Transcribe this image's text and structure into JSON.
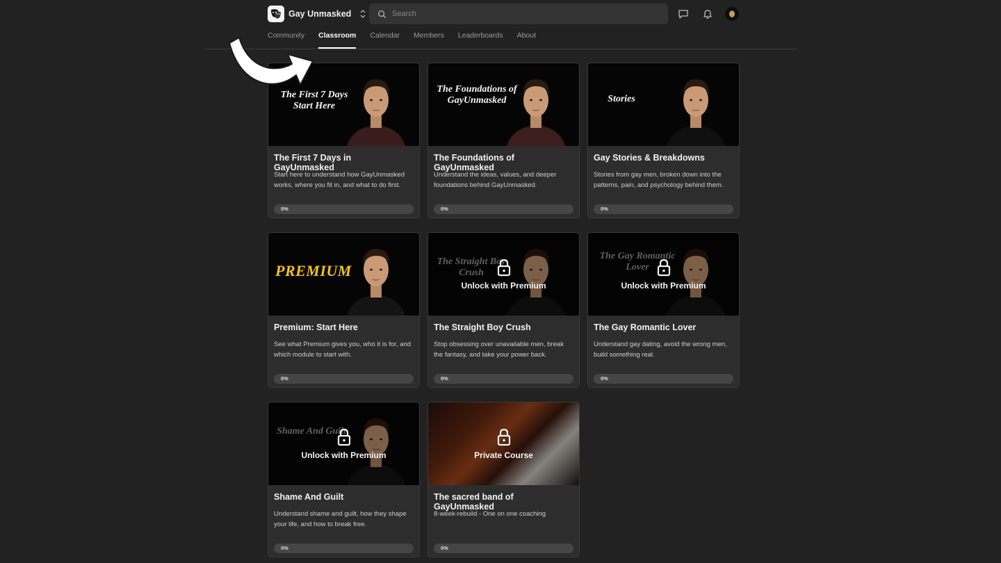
{
  "header": {
    "brand_name": "Gay Unmasked",
    "search_placeholder": "Search",
    "accent": "#ffffff"
  },
  "nav": {
    "tabs": [
      {
        "label": "Community",
        "active": false
      },
      {
        "label": "Classroom",
        "active": true
      },
      {
        "label": "Calendar",
        "active": false
      },
      {
        "label": "Members",
        "active": false
      },
      {
        "label": "Leaderboards",
        "active": false
      },
      {
        "label": "About",
        "active": false
      }
    ]
  },
  "courses": [
    {
      "thumb_text": "The First 7 Days\nStart Here",
      "title": "The First 7 Days in GayUnmasked",
      "description": "Start here to understand how GayUnmasked works, where you fit in, and what to do first.",
      "progress": 0,
      "progress_label": "0%",
      "locked": false
    },
    {
      "thumb_text": "The Foundations of\nGayUnmasked",
      "title": "The Foundations of GayUnmasked",
      "description": "Understand the ideas, values, and deeper foundations behind GayUnmasked.",
      "progress": 0,
      "progress_label": "0%",
      "locked": false
    },
    {
      "thumb_text": "Stories",
      "title": "Gay Stories & Breakdowns",
      "description": "Stories from gay men, broken down into the patterns, pain, and psychology behind them.",
      "progress": 0,
      "progress_label": "0%",
      "locked": false
    },
    {
      "thumb_text": "PREMIUM",
      "title": "Premium: Start Here",
      "description": "See what Premium gives you, who it is for, and which module to start with.",
      "progress": 0,
      "progress_label": "0%",
      "locked": false
    },
    {
      "thumb_text": "The Straight Boy\nCrush",
      "title": "The Straight Boy Crush",
      "description": "Stop obsessing over unavailable men, break the fantasy, and take your power back.",
      "progress": 0,
      "progress_label": "0%",
      "locked": true,
      "lock_label": "Unlock with Premium"
    },
    {
      "thumb_text": "The Gay Romantic\nLover",
      "title": "The Gay Romantic Lover",
      "description": "Understand gay dating, avoid the wrong men, build something real.",
      "progress": 0,
      "progress_label": "0%",
      "locked": true,
      "lock_label": "Unlock with Premium"
    },
    {
      "thumb_text": "Shame And Guilt",
      "title": "Shame And Guilt",
      "description": "Understand shame and guilt, how they shape your life, and how to break free.",
      "progress": 0,
      "progress_label": "0%",
      "locked": true,
      "lock_label": "Unlock with Premium"
    },
    {
      "thumb_text": "",
      "title": "The sacred band of GayUnmasked",
      "description": "8-week-rebuild - One on one coaching",
      "progress": 0,
      "progress_label": "0%",
      "locked": true,
      "lock_label": "Private Course"
    }
  ],
  "icons": [
    "search-icon",
    "chat-icon",
    "bell-icon",
    "chevron-updown-icon",
    "lock-icon",
    "arrow-icon"
  ]
}
